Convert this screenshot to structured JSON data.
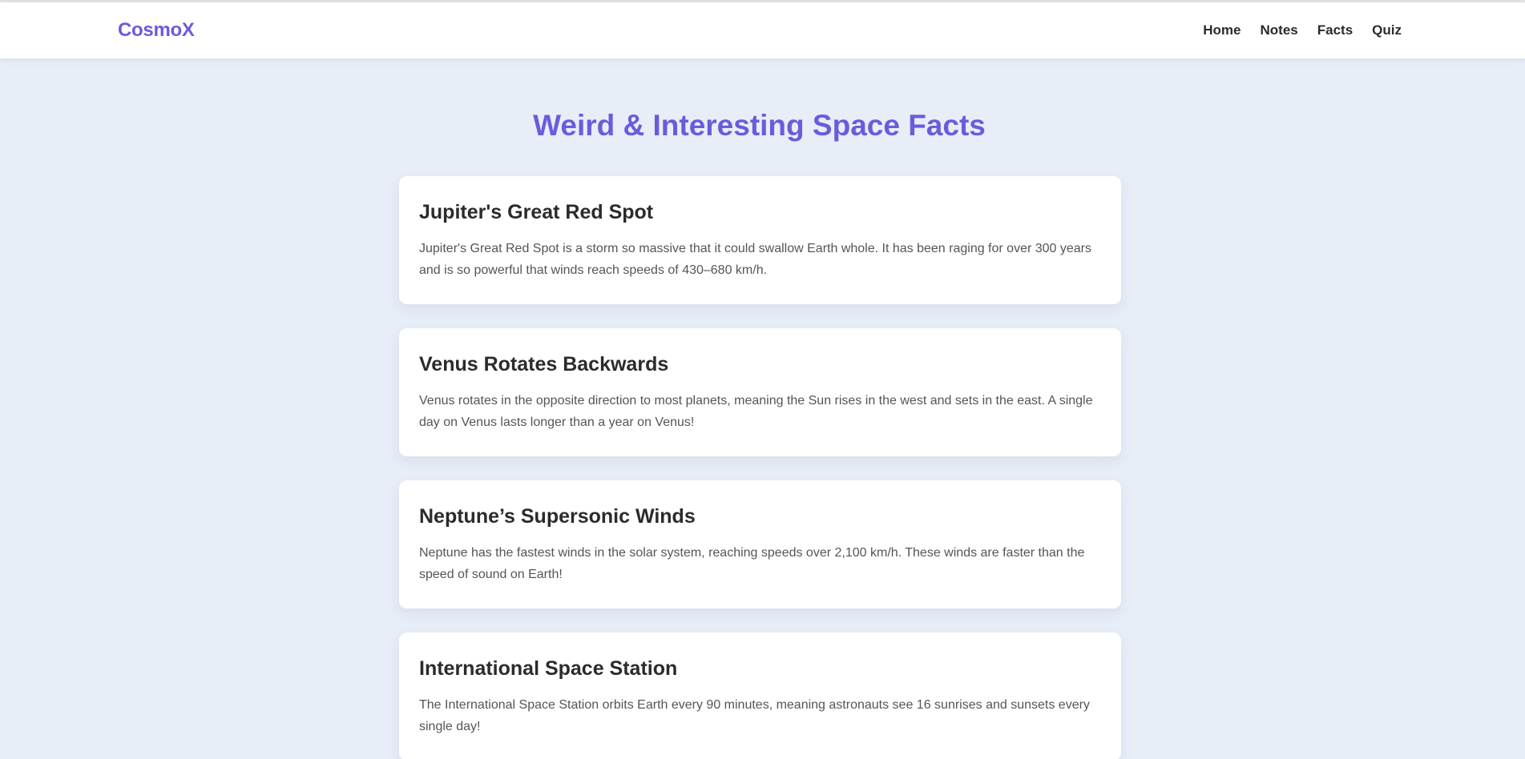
{
  "header": {
    "logo": "CosmoX",
    "nav": [
      {
        "label": "Home"
      },
      {
        "label": "Notes"
      },
      {
        "label": "Facts"
      },
      {
        "label": "Quiz"
      }
    ]
  },
  "main": {
    "title": "Weird & Interesting Space Facts",
    "facts": [
      {
        "title": "Jupiter's Great Red Spot",
        "text": "Jupiter's Great Red Spot is a storm so massive that it could swallow Earth whole. It has been raging for over 300 years and is so powerful that winds reach speeds of 430–680 km/h."
      },
      {
        "title": "Venus Rotates Backwards",
        "text": "Venus rotates in the opposite direction to most planets, meaning the Sun rises in the west and sets in the east. A single day on Venus lasts longer than a year on Venus!"
      },
      {
        "title": "Neptune’s Supersonic Winds",
        "text": "Neptune has the fastest winds in the solar system, reaching speeds over 2,100 km/h. These winds are faster than the speed of sound on Earth!"
      },
      {
        "title": "International Space Station",
        "text": "The International Space Station orbits Earth every 90 minutes, meaning astronauts see 16 sunrises and sunsets every single day!"
      }
    ]
  },
  "colors": {
    "accent": "#6b5bdc",
    "background": "#e8eef7",
    "card": "#ffffff",
    "text": "#2b2b2b",
    "muted_text": "#555555"
  }
}
